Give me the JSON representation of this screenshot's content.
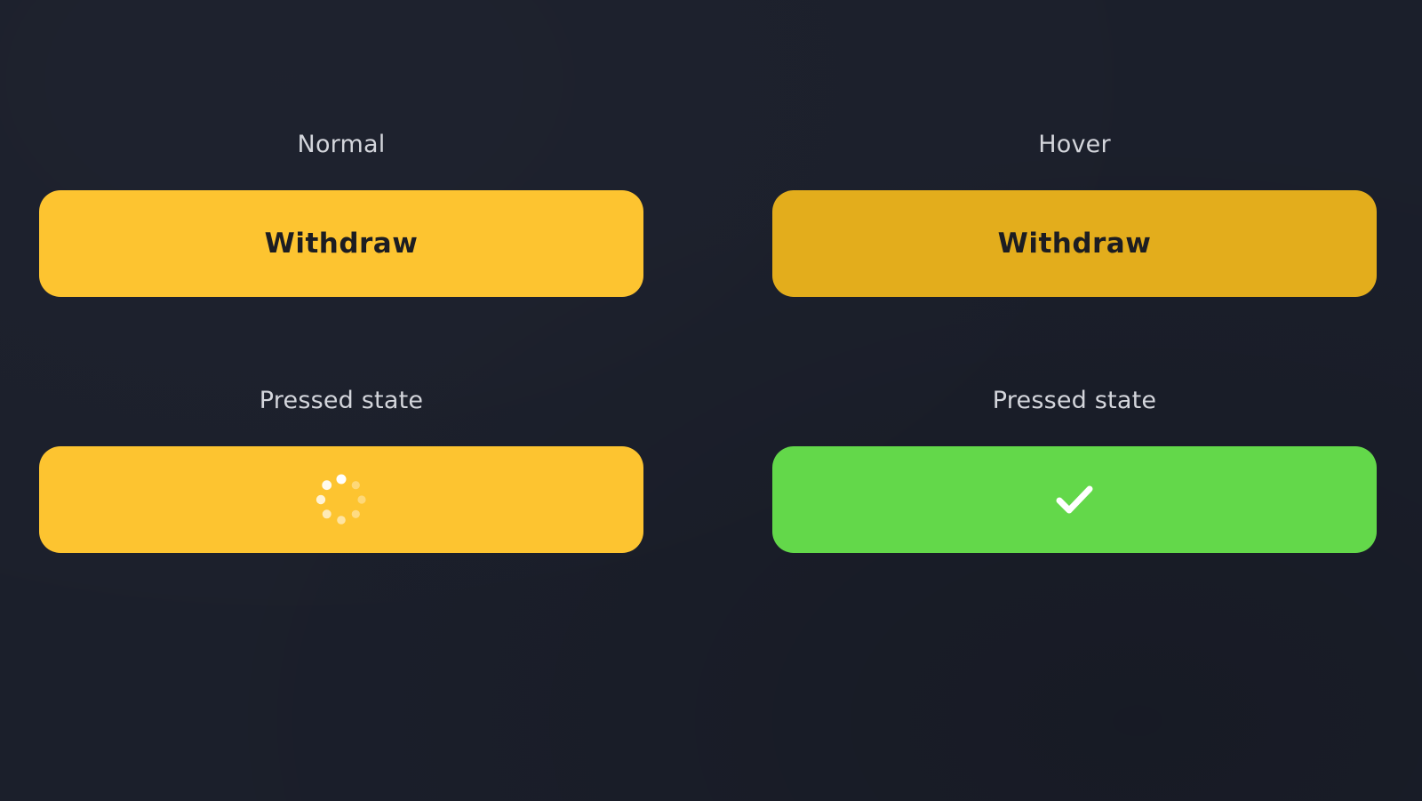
{
  "colors": {
    "background": "#1b1f2b",
    "normal": "#fdc430",
    "hover": "#e3ad1c",
    "pressed_loading": "#fdc430",
    "pressed_success": "#63d84a",
    "label_text": "#d3d5db",
    "button_text": "#1c1d22"
  },
  "states": [
    {
      "label": "Normal",
      "button_label": "Withdraw"
    },
    {
      "label": "Hover",
      "button_label": "Withdraw"
    },
    {
      "label": "Pressed state",
      "icon": "loading-spinner-icon"
    },
    {
      "label": "Pressed state",
      "icon": "checkmark-icon"
    }
  ]
}
